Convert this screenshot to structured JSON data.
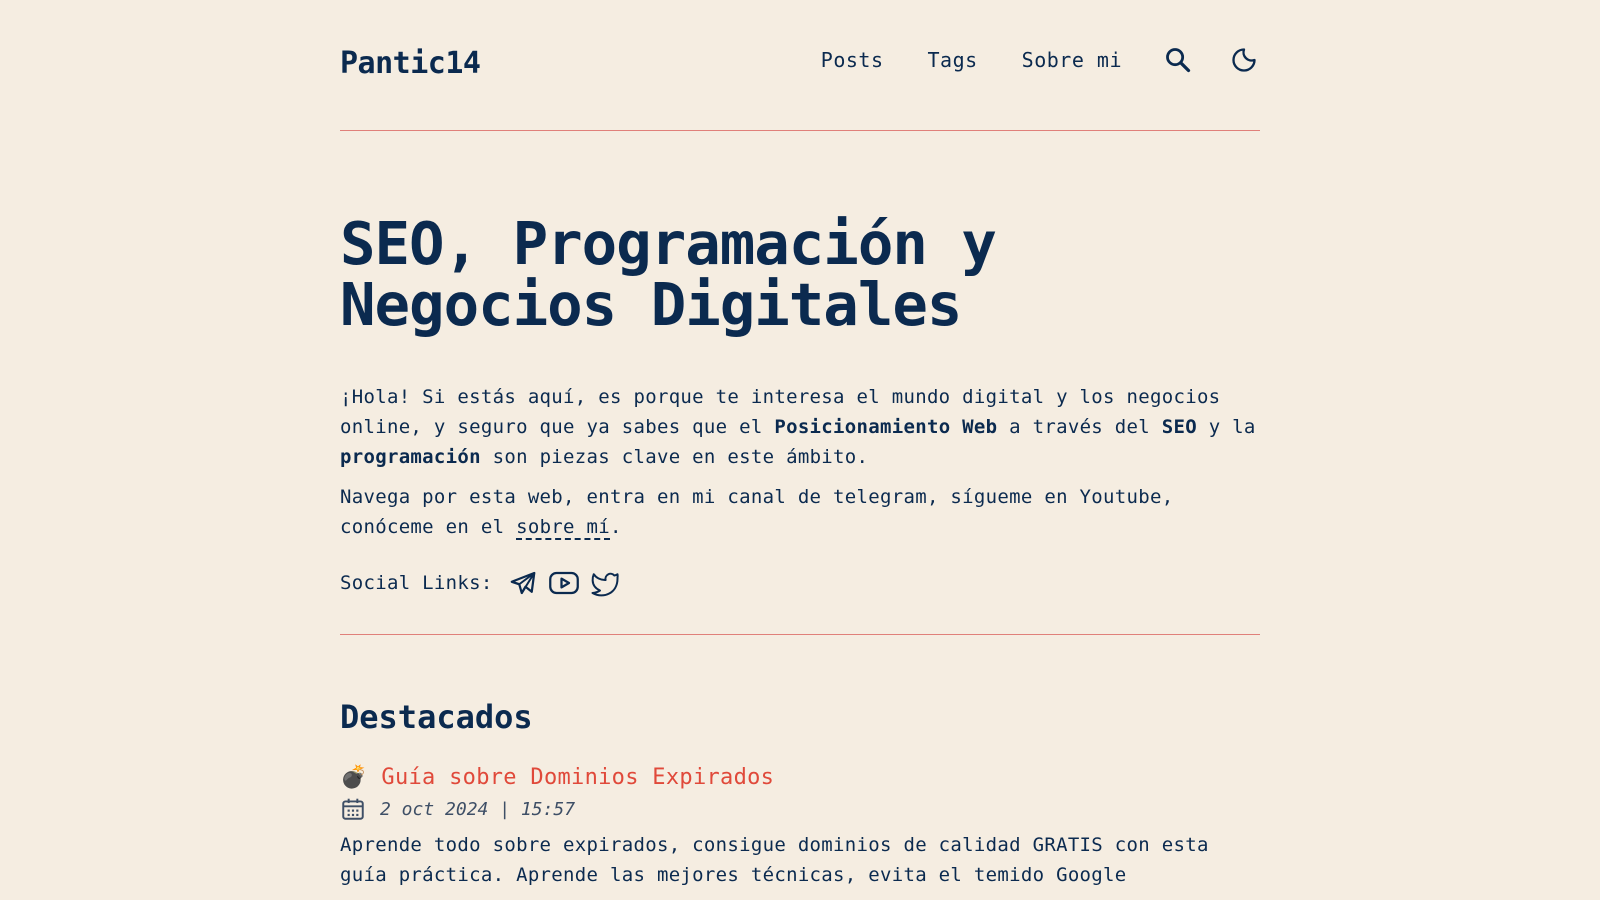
{
  "header": {
    "logo": "Pantic14",
    "nav": [
      "Posts",
      "Tags",
      "Sobre mi"
    ],
    "icons": [
      "search-icon",
      "moon-icon"
    ]
  },
  "hero": {
    "title_line1": "SEO, Programación y",
    "title_line2": "Negocios Digitales",
    "intro_part1": "¡Hola! Si estás aquí, es porque te interesa el mundo digital y los negocios online, y seguro que ya sabes que el ",
    "intro_bold1": "Posicionamiento Web",
    "intro_part2": " a través del ",
    "intro_bold2": "SEO",
    "intro_part3": " y la ",
    "intro_bold3": "programación",
    "intro_part4": " son piezas clave en este ámbito.",
    "intro2_part1": "Navega por esta web, entra en mi canal de telegram, sígueme en Youtube, conóceme en el ",
    "intro2_link": "sobre mí",
    "intro2_part2": ".",
    "social_label": "Social Links:",
    "social_icons": [
      "telegram-icon",
      "youtube-icon",
      "twitter-icon"
    ]
  },
  "featured": {
    "section_title": "Destacados",
    "posts": [
      {
        "emoji": "💣",
        "title": "Guía sobre Dominios Expirados",
        "date": "2 oct 2024 | 15:57",
        "desc_part1": "Aprende todo sobre expirados, consigue dominios de calidad GRATIS con esta guía práctica. Aprende las mejores técnicas, evita el temido Google "
      }
    ]
  },
  "colors": {
    "background": "#f5ede1",
    "text": "#0b2a4f",
    "accent": "#e0493a",
    "divider": "#e0807a"
  }
}
